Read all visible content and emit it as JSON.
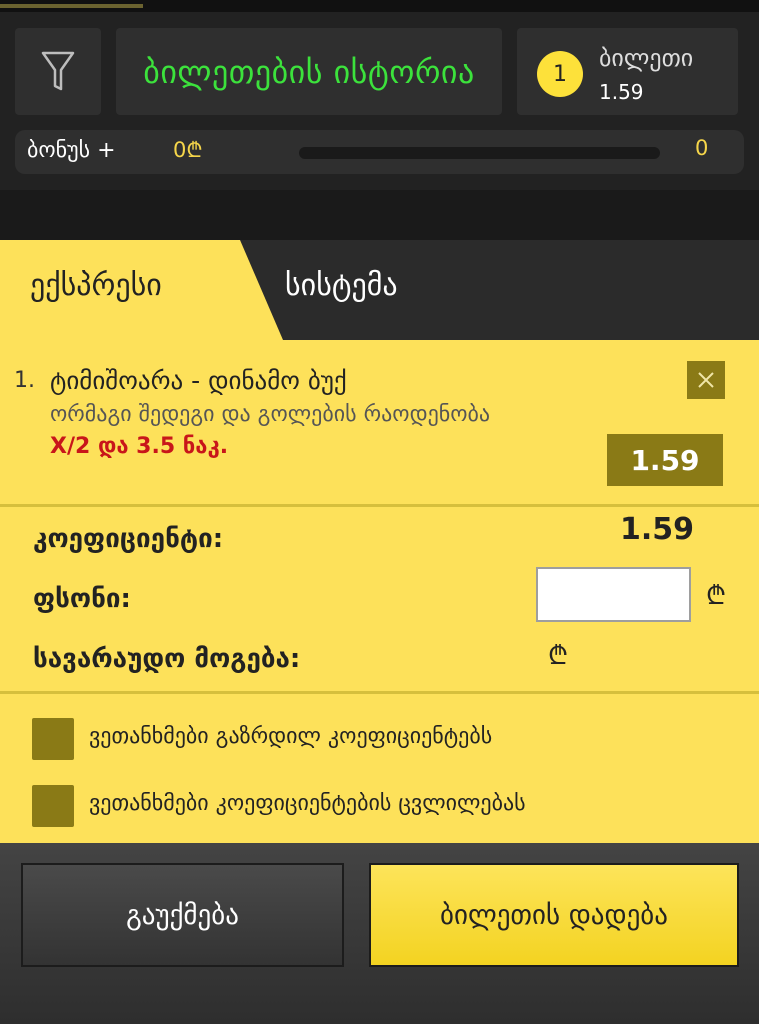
{
  "header": {
    "history_label": "ბილეთების ისტორია",
    "ticket_count": "1",
    "ticket_label": "ბილეთი",
    "ticket_odds": "1.59"
  },
  "bonus": {
    "label": "ბონუს +",
    "amount": "0₾",
    "count": "0",
    "progress_fraction": 0
  },
  "tabs": {
    "express": "ექსპრესი",
    "system": "სისტემა"
  },
  "bet": {
    "number": "1.",
    "match": "ტიმიშოარა - დინამო ბუქ",
    "market": "ორმაგი შედეგი და გოლების რაოდენობა",
    "selection": "X/2 და 3.5 ნაკ.",
    "odds": "1.59",
    "remove_glyph": "✕"
  },
  "summary": {
    "coefficient_label": "კოეფიციენტი:",
    "coefficient_value": "1.59",
    "stake_label": "ფსონი:",
    "stake_value": "",
    "stake_currency": "₾",
    "potential_label": "სავარაუდო მოგება:",
    "potential_currency": "₾"
  },
  "options": {
    "accept_increased": "ვეთანხმები გაზრდილ კოეფიციენტებს",
    "accept_changes": "ვეთანხმები კოეფიციენტების ცვლილებას"
  },
  "footer": {
    "cancel": "გაუქმება",
    "place": "ბილეთის დადება"
  },
  "colors": {
    "accent_yellow": "#fde15a",
    "dark_olive": "#8a7a16",
    "history_green": "#3ce23c",
    "selection_red": "#c8161a"
  }
}
